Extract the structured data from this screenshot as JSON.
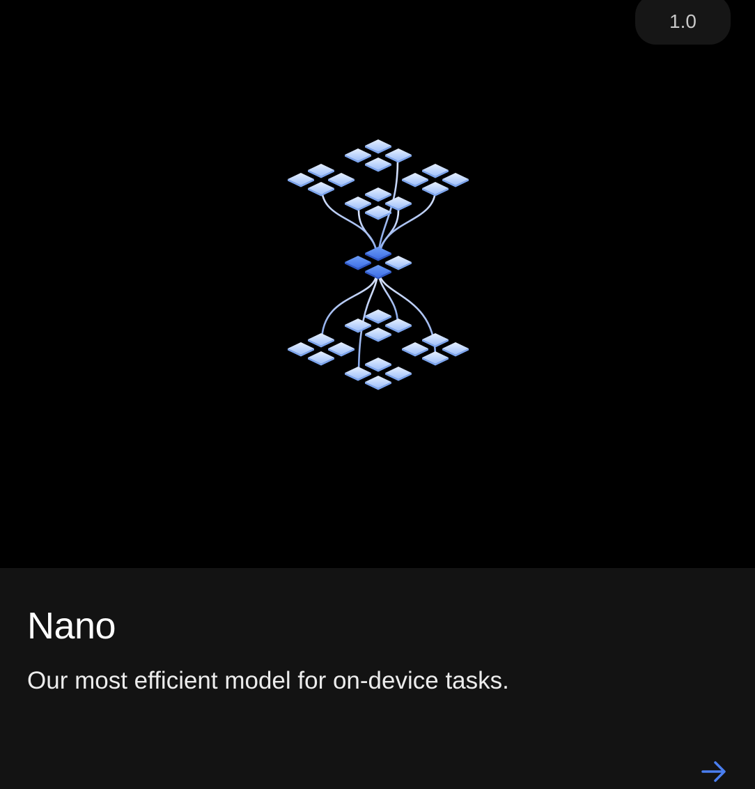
{
  "card": {
    "version": "1.0",
    "title": "Nano",
    "description": "Our most efficient model for on-device tasks.",
    "illustration_icon": "model-network-icon",
    "action_icon": "arrow-right-icon"
  },
  "colors": {
    "hero_background": "#000000",
    "info_background": "#131313",
    "badge_background": "#161616",
    "badge_text": "#c8c8c8",
    "title_text": "#ffffff",
    "accent_blue": "#4a7ef0",
    "tile_light": "#cfe0ff",
    "tile_mid": "#9dbdf8"
  }
}
